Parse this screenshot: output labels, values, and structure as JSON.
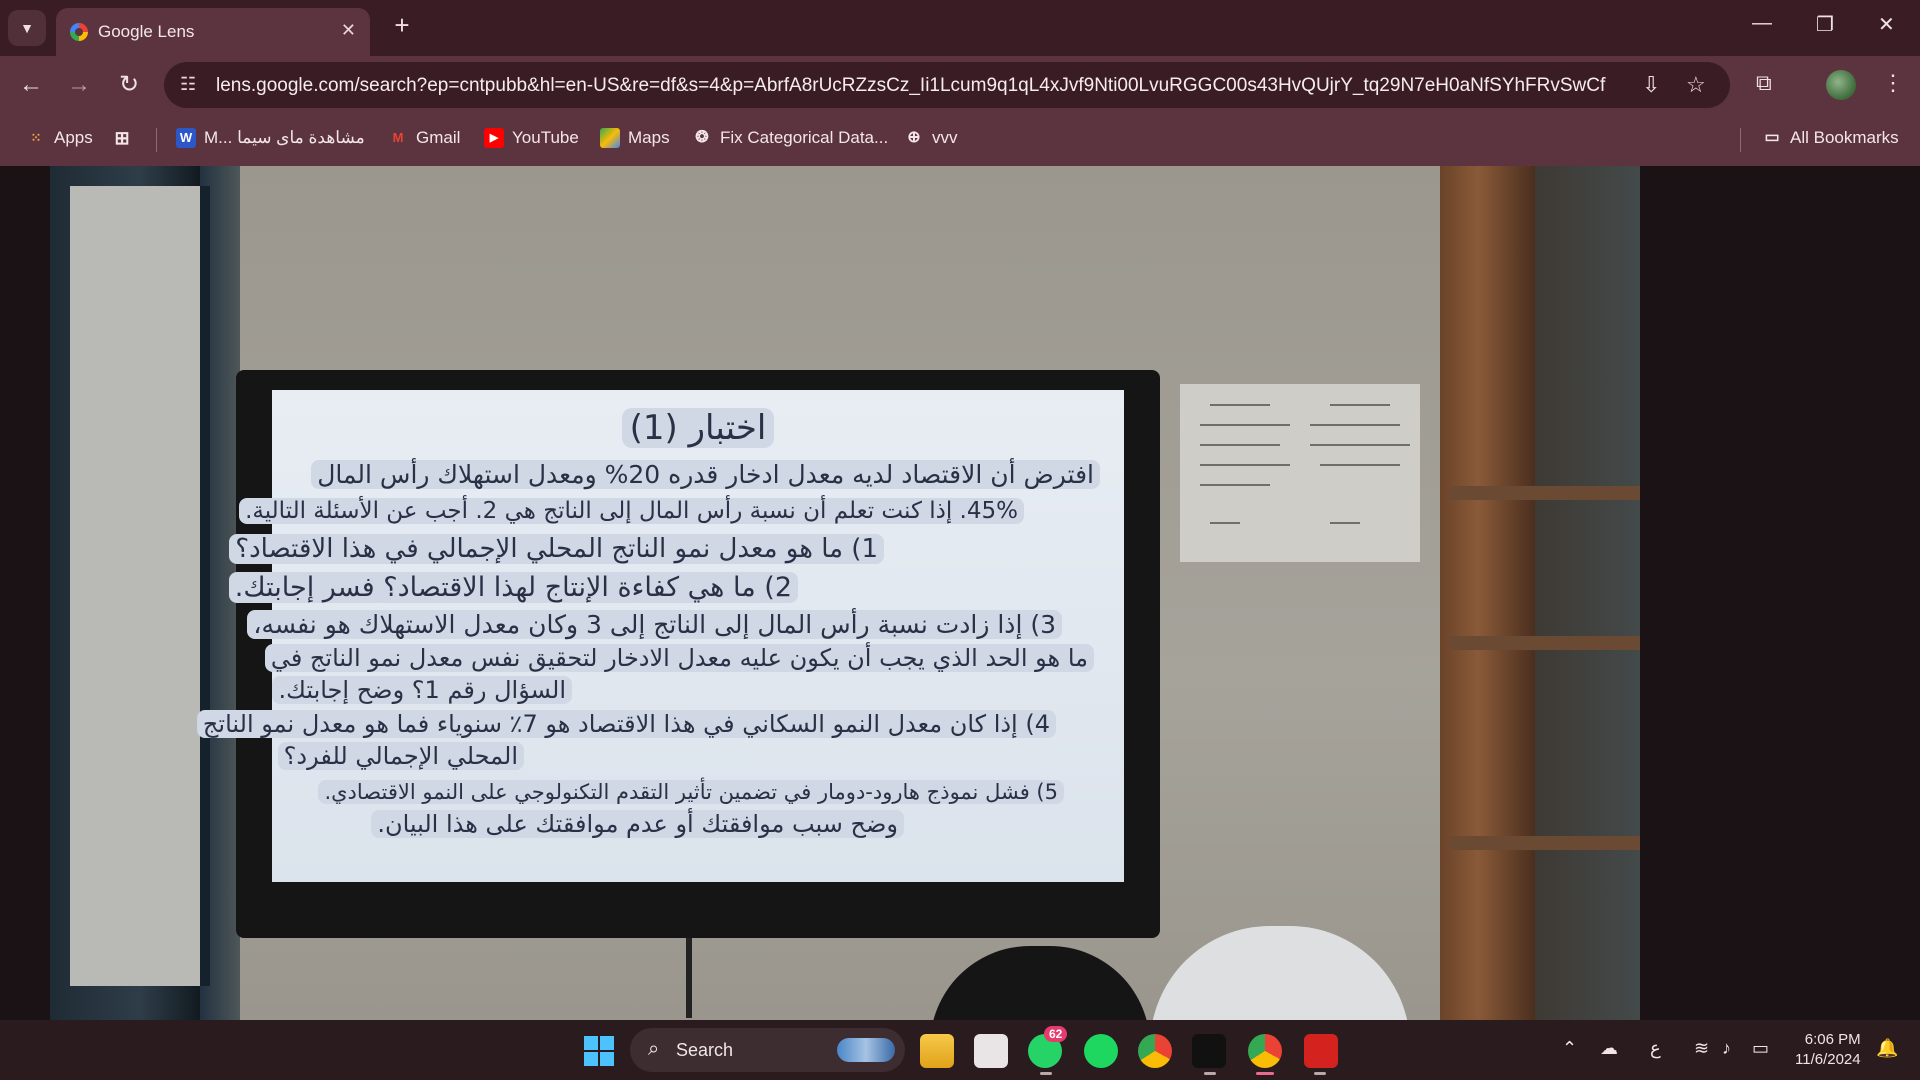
{
  "browser": {
    "tab_title": "Google Lens",
    "url": "lens.google.com/search?ep=cntpubb&hl=en-US&re=df&s=4&p=AbrfA8rUcRZzsCz_Ii1Lcum9q1qL4xJvf9Nti00LvuRGGC00s43HvQUjrY_tq29N7eH0aNfSYhFRvSwCfV4...",
    "bookmarks": [
      {
        "label": "Apps",
        "icon": "apps-grid-icon"
      },
      {
        "label": "",
        "icon": "tab-groups-icon"
      },
      {
        "label": "M... مشاهدة ماى سيما",
        "icon": "w-icon"
      },
      {
        "label": "Gmail",
        "icon": "gmail-icon"
      },
      {
        "label": "YouTube",
        "icon": "youtube-icon"
      },
      {
        "label": "Maps",
        "icon": "maps-icon"
      },
      {
        "label": "Fix Categorical Data...",
        "icon": "openai-icon"
      },
      {
        "label": "vvv",
        "icon": "globe-icon"
      }
    ],
    "all_bookmarks": "All Bookmarks"
  },
  "image_text": {
    "title": "اختبار (1)",
    "lines": [
      "افترض أن الاقتصاد لديه معدل ادخار قدره 20% ومعدل استهلاك رأس المال",
      "45%. إذا كنت تعلم أن نسبة رأس المال إلى الناتج هي 2. أجب عن الأسئلة التالية.",
      "1) ما هو معدل نمو الناتج المحلي الإجمالي في هذا الاقتصاد؟",
      "2) ما هي كفاءة الإنتاج لهذا الاقتصاد؟ فسر إجابتك.",
      "3) إذا زادت نسبة رأس المال إلى الناتج إلى 3 وكان معدل الاستهلاك هو نفسه،",
      "ما هو الحد الذي يجب أن يكون عليه معدل الادخار لتحقيق نفس معدل نمو الناتج في",
      "السؤال رقم 1؟ وضح إجابتك.",
      "4) إذا كان معدل النمو السكاني في هذا الاقتصاد هو 7٪ سنوياء فما هو معدل نمو الناتج",
      "المحلي الإجمالي للفرد؟",
      "5) فشل نموذج هارود-دومار في تضمين تأثير التقدم التكنولوجي على النمو الاقتصادي.",
      "وضح سبب موافقتك أو عدم موافقتك على هذا البيان."
    ]
  },
  "taskbar": {
    "search_label": "Search",
    "whatsapp_badge": "62",
    "keyboard_lang": "ع",
    "time": "6:06 PM",
    "date": "11/6/2024"
  },
  "colors": {
    "tab_bar": "#3a1d24",
    "toolbar": "#5c3440",
    "taskbar": "#2a1b1e",
    "accent": "#4cc2ff"
  }
}
